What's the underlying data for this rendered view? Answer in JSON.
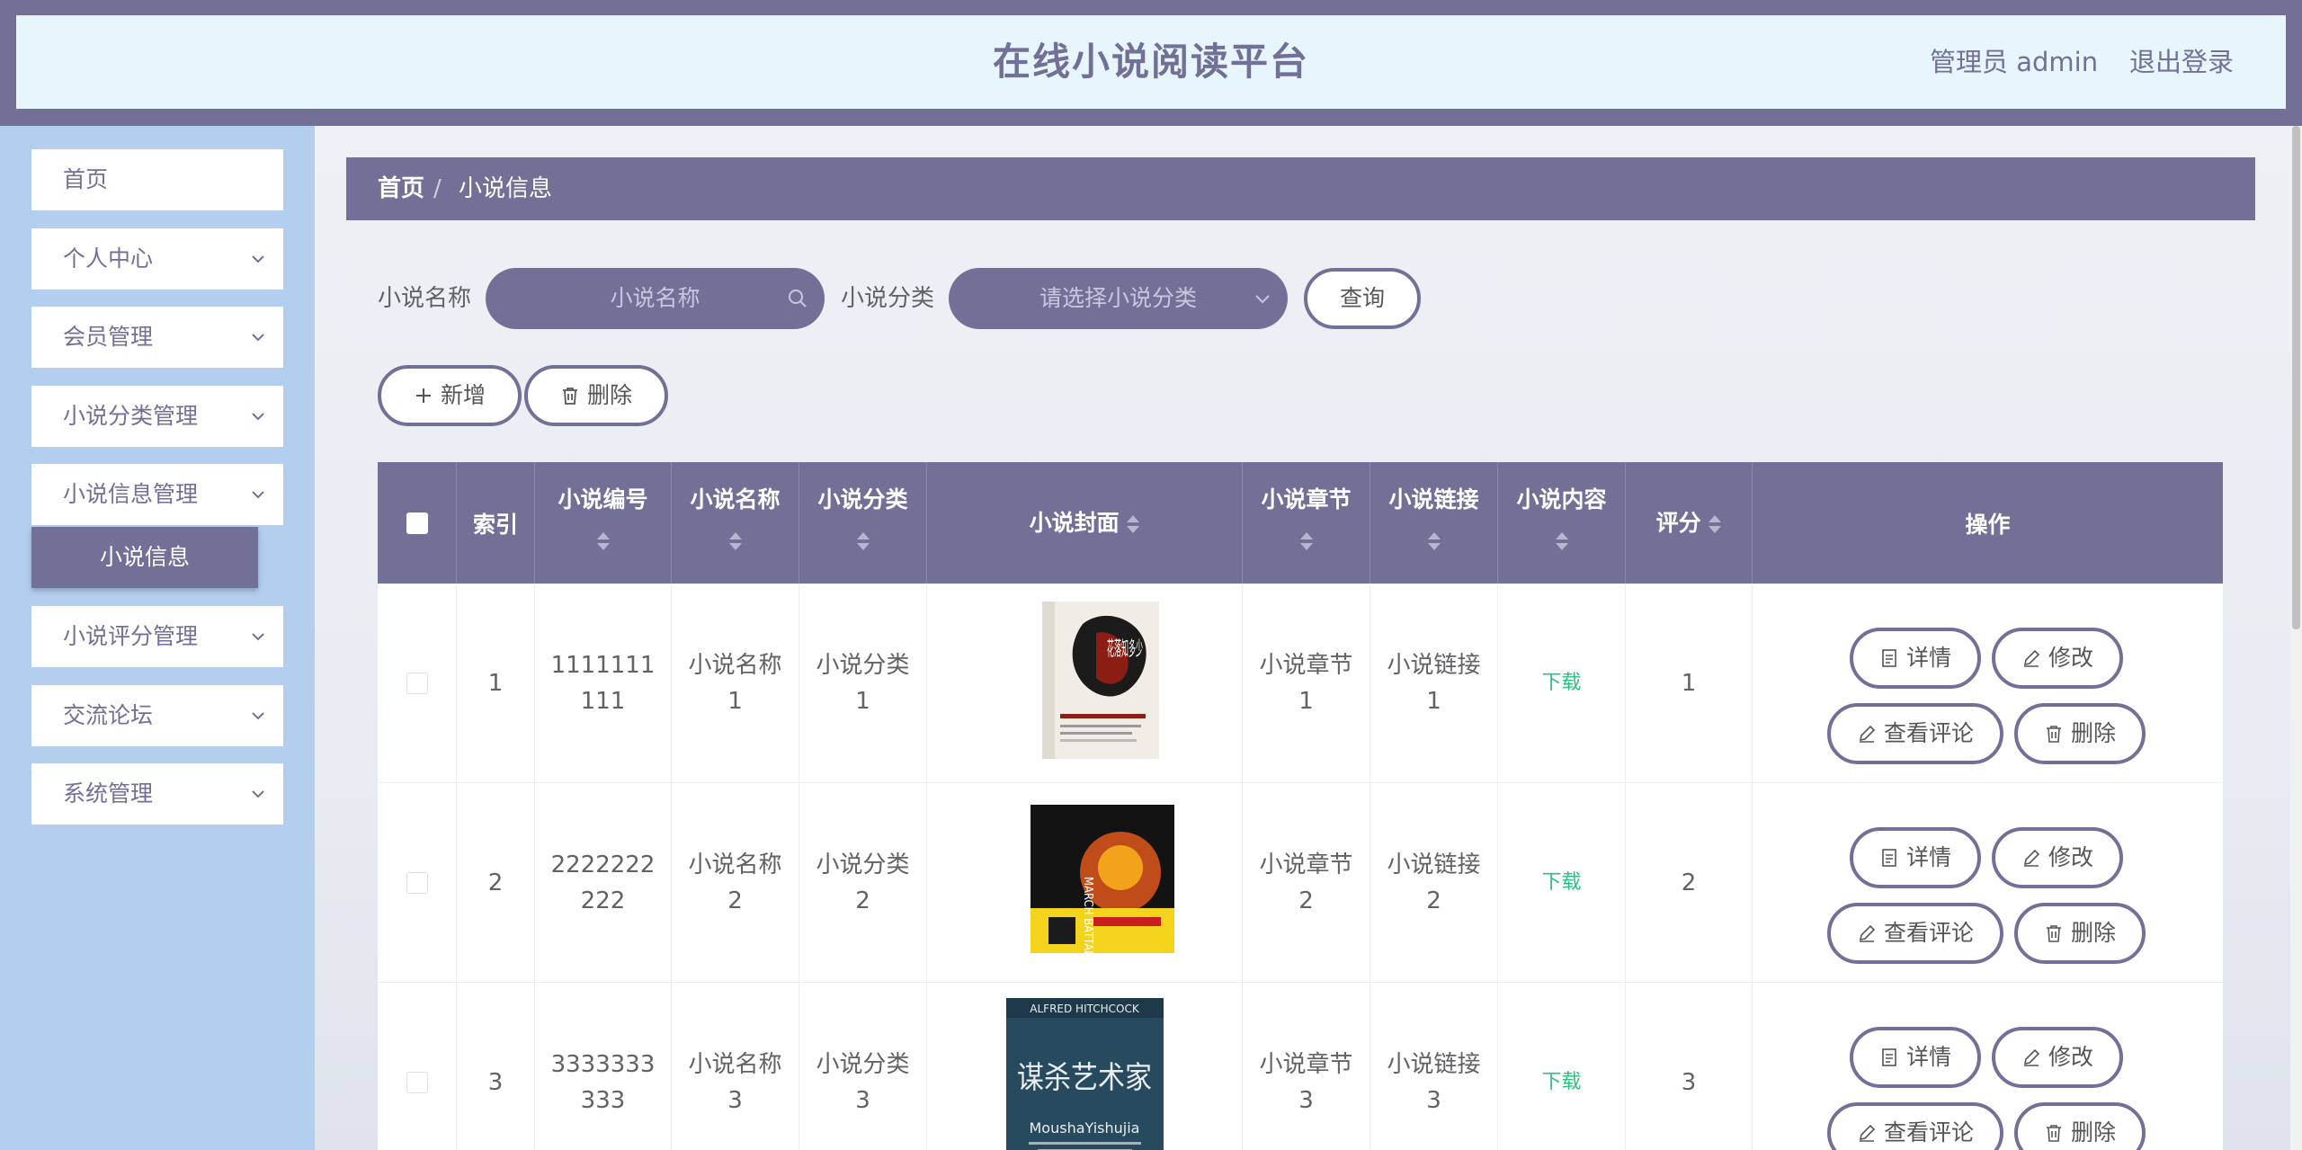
{
  "header": {
    "title": "在线小说阅读平台",
    "user": "管理员 admin",
    "logout": "退出登录"
  },
  "sidebar": {
    "items": [
      {
        "label": "首页"
      },
      {
        "label": "个人中心"
      },
      {
        "label": "会员管理"
      },
      {
        "label": "小说分类管理"
      },
      {
        "label": "小说信息管理"
      },
      {
        "label": "小说评分管理"
      },
      {
        "label": "交流论坛"
      },
      {
        "label": "系统管理"
      }
    ],
    "active_sub": "小说信息"
  },
  "breadcrumb": {
    "home": "首页",
    "sep": "/",
    "current": "小说信息"
  },
  "search": {
    "name_label": "小说名称",
    "name_placeholder": "小说名称",
    "type_label": "小说分类",
    "type_placeholder": "请选择小说分类",
    "query": "查询"
  },
  "actions": {
    "add": "新增",
    "delete": "删除"
  },
  "table": {
    "headers": [
      "索引",
      "小说编号",
      "小说名称",
      "小说分类",
      "小说封面",
      "小说章节",
      "小说链接",
      "小说内容",
      "评分",
      "操作"
    ],
    "rows": [
      {
        "index": "1",
        "code": "1111111111",
        "name": "小说名称1",
        "category": "小说分类1",
        "chapter": "小说章节1",
        "link": "小说链接1",
        "content": "下载",
        "score": "1"
      },
      {
        "index": "2",
        "code": "2222222222",
        "name": "小说名称2",
        "category": "小说分类2",
        "chapter": "小说章节2",
        "link": "小说链接2",
        "content": "下载",
        "score": "2"
      },
      {
        "index": "3",
        "code": "3333333333",
        "name": "小说名称3",
        "category": "小说分类3",
        "chapter": "小说章节3",
        "link": "小说链接3",
        "content": "下载",
        "score": "3"
      }
    ],
    "row_actions": {
      "detail": "详情",
      "edit": "修改",
      "comments": "查看评论",
      "delete": "删除"
    }
  },
  "covers": [
    {
      "title_text": "花落知多少",
      "bg": "#f1ede6",
      "accent": "#8b1d13"
    },
    {
      "title_text": "MARCH BATTALION",
      "bg": "#131313",
      "accent": "#f3d31c"
    },
    {
      "title_text": "谋杀艺术家",
      "sub_text": "ALFRED HITCHCOCK",
      "bottom_text": "MoushaYishujia",
      "bg": "#274a5f",
      "accent": "#e8eef2"
    }
  ]
}
